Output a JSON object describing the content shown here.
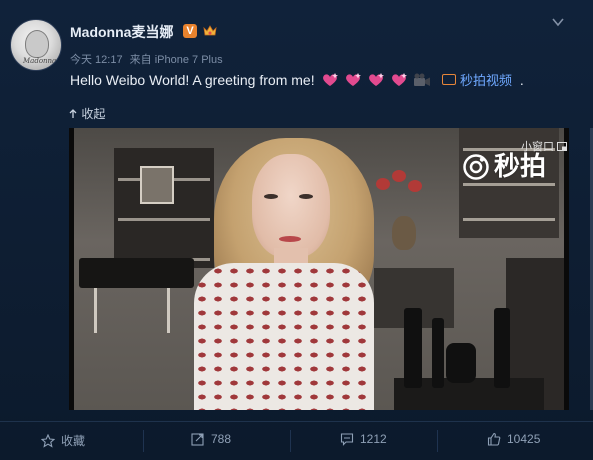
{
  "post": {
    "user_name": "Madonna麦当娜",
    "verified_badge": "V",
    "avatar_signature": "Madonna",
    "time": "今天 12:17",
    "source": "来自 iPhone 7 Plus",
    "text": "Hello Weibo World! A greeting from me!",
    "video_link_label": "秒拍视频",
    "trailing_dot": ".",
    "collapse_label": "收起"
  },
  "video": {
    "brand": "秒拍",
    "mini_window_label": "小窗口",
    "progress_fraction": 0.0
  },
  "actions": {
    "favorite_label": "收藏",
    "repost_count": "788",
    "comment_count": "1212",
    "like_count": "10425"
  },
  "colors": {
    "background": "#10223a",
    "link": "#6fa8ff",
    "verified_badge": "#e8822d",
    "heart": "#e24a8f",
    "progress": "#49c46d"
  },
  "icons": {
    "hearts": [
      "sparkling-heart-icon",
      "sparkling-heart-icon",
      "sparkling-heart-icon",
      "sparkling-heart-icon",
      "movie-camera-icon"
    ]
  }
}
